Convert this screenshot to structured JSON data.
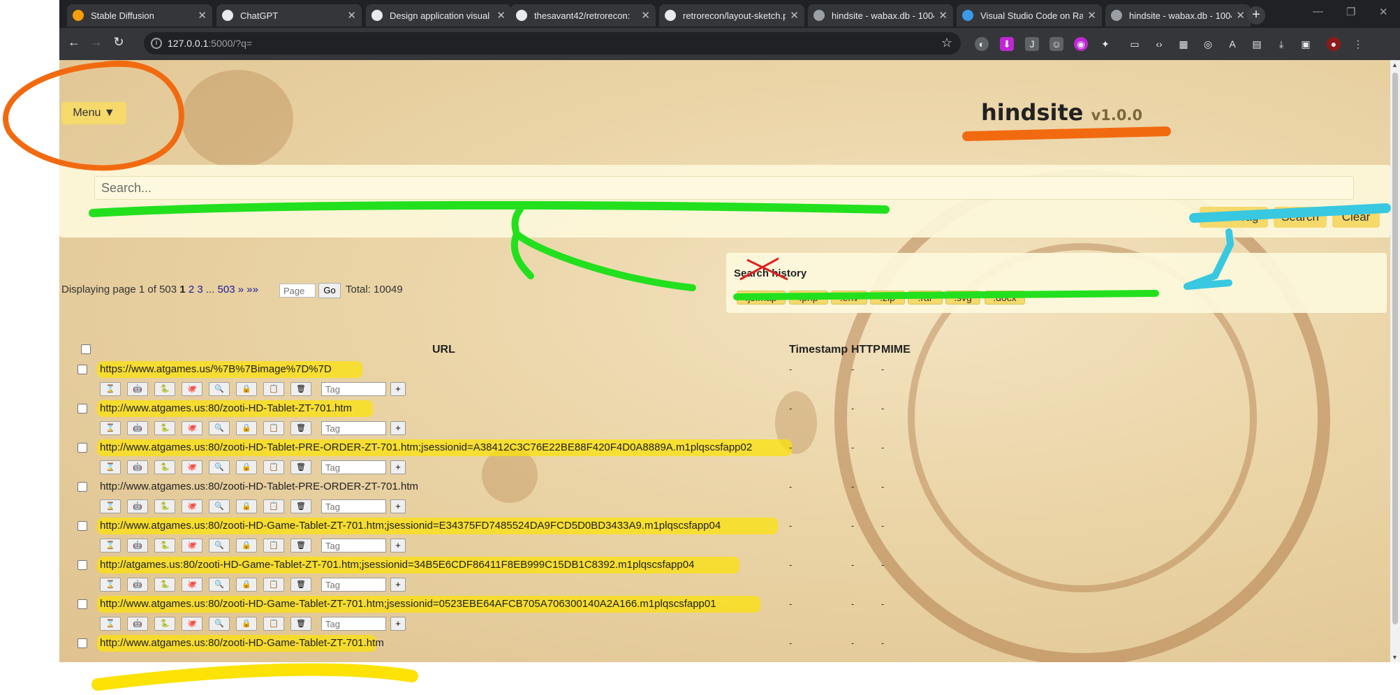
{
  "browser": {
    "tabs": [
      {
        "title": "Stable Diffusion",
        "icon": "stable-diffusion-icon",
        "color": "#f59e0b"
      },
      {
        "title": "ChatGPT",
        "icon": "openai-icon",
        "color": "#e8eaed"
      },
      {
        "title": "Design application visual l",
        "icon": "openai-icon",
        "color": "#e8eaed"
      },
      {
        "title": "thesavant42/retrorecon:",
        "icon": "github-icon",
        "color": "#e8eaed"
      },
      {
        "title": "retrorecon/layout-sketch.p",
        "icon": "github-icon",
        "color": "#e8eaed"
      },
      {
        "title": "hindsite - wabax.db - 1004",
        "icon": "globe-icon",
        "color": "#9aa0a6"
      },
      {
        "title": "Visual Studio Code on Ras",
        "icon": "vscode-icon",
        "color": "#3b9ae8"
      },
      {
        "title": "hindsite - wabax.db - 1004",
        "icon": "globe-icon",
        "color": "#9aa0a6"
      }
    ],
    "url_host": "127.0.0.1",
    "url_rest": ":5000/?q="
  },
  "app": {
    "menu_label": "Menu ▼",
    "brand": "hindsite",
    "version": "v1.0.0"
  },
  "search": {
    "placeholder": "Search...",
    "save_tag": "Save Tag",
    "search_btn": "Search",
    "clear_btn": "Clear"
  },
  "history": {
    "title": "Search history",
    "chips": [
      ".js.map",
      ".php",
      ".env",
      ".zip",
      ".rar",
      ".svg",
      ".docx"
    ]
  },
  "pager": {
    "text_prefix": "Displaying page 1 of 503",
    "current": "1",
    "links": [
      "2",
      "3",
      "...",
      "503",
      "»",
      "»»"
    ],
    "page_placeholder": "Page",
    "go": "Go",
    "total": "Total: 10049"
  },
  "table": {
    "headers": {
      "url": "URL",
      "timestamp": "Timestamp",
      "http": "HTTP",
      "mime": "MIME"
    },
    "tag_placeholder": "Tag",
    "add_label": "+",
    "empty_cell": "-",
    "rows": [
      "https://www.atgames.us/%7B%7Bimage%7D%7D",
      "http://www.atgames.us:80/zooti-HD-Tablet-ZT-701.htm",
      "http://www.atgames.us:80/zooti-HD-Tablet-PRE-ORDER-ZT-701.htm;jsessionid=A38412C3C76E22BE88F420F4D0A8889A.m1plqscsfapp02",
      "http://www.atgames.us:80/zooti-HD-Tablet-PRE-ORDER-ZT-701.htm",
      "http://www.atgames.us:80/zooti-HD-Game-Tablet-ZT-701.htm;jsessionid=E34375FD7485524DA9FCD5D0BD3433A9.m1plqscsfapp04",
      "http://atgames.us:80/zooti-HD-Game-Tablet-ZT-701.htm;jsessionid=34B5E6CDF86411F8EB999C15DB1C8392.m1plqscsfapp04",
      "http://www.atgames.us:80/zooti-HD-Game-Tablet-ZT-701.htm;jsessionid=0523EBE64AFCB705A706300140A2A166.m1plqscsfapp01",
      "http://www.atgames.us:80/zooti-HD-Game-Tablet-ZT-701.htm"
    ]
  },
  "row_tools": [
    "hourglass-icon",
    "robot-icon",
    "snake-icon",
    "octopus-icon",
    "magnifier-icon",
    "lock-icon",
    "clipboard-icon",
    "trash-icon"
  ],
  "annotation_colors": {
    "orange": "#f26a10",
    "green": "#22e01e",
    "cyan": "#38c8e0",
    "yellow": "#fce205"
  }
}
